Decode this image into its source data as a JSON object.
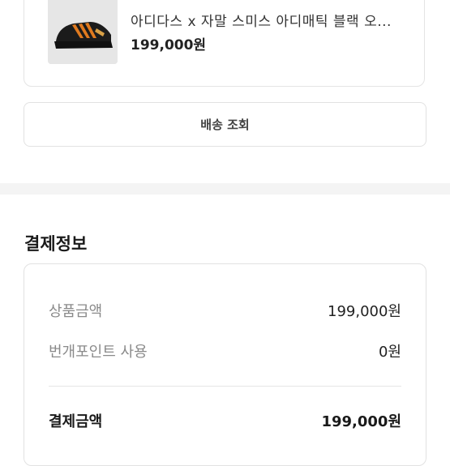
{
  "product": {
    "name": "아디다스 x 자말 스미스 아디매틱 블랙 오...",
    "price": "199,000원",
    "image": "sneaker-image"
  },
  "delivery": {
    "tracking_label": "배송 조회"
  },
  "payment_info": {
    "title": "결제정보",
    "rows": [
      {
        "label": "상품금액",
        "value": "199,000원"
      },
      {
        "label": "번개포인트 사용",
        "value": "0원"
      }
    ],
    "total": {
      "label": "결제금액",
      "value": "199,000원"
    }
  }
}
